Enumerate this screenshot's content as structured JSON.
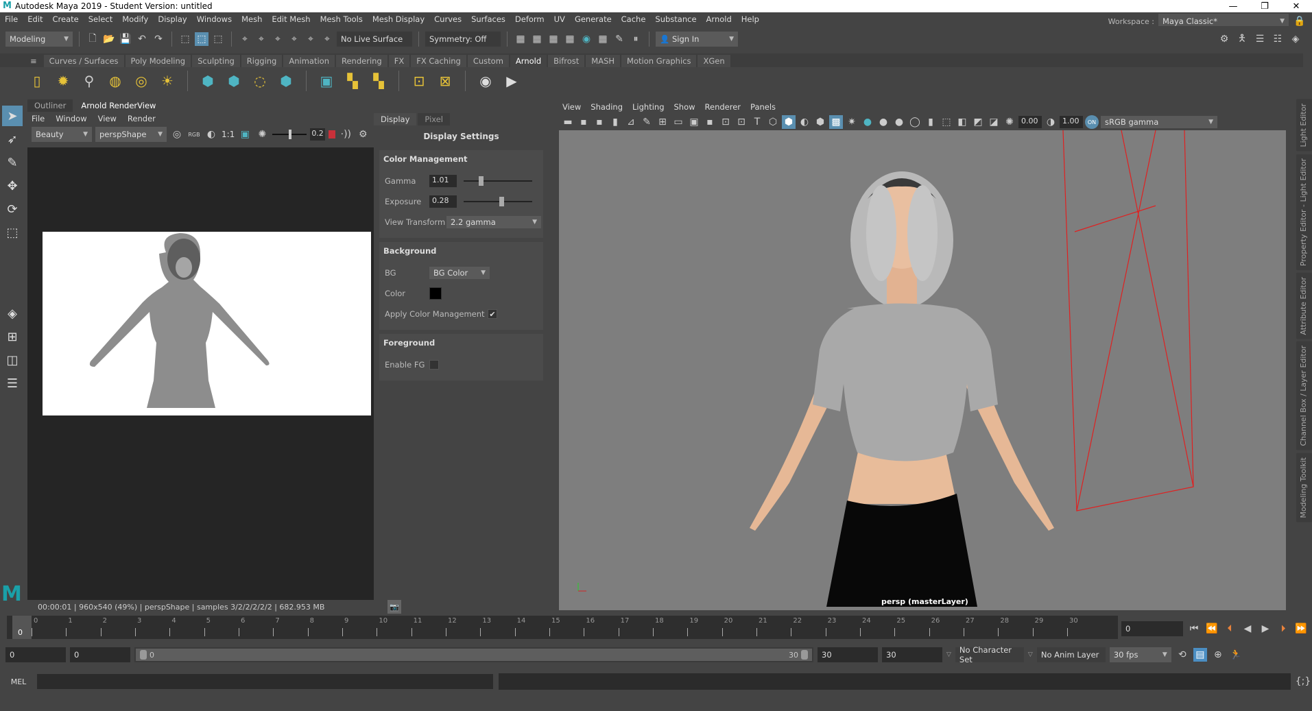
{
  "window": {
    "title": "Autodesk Maya 2019 - Student Version: untitled",
    "controls": [
      "minimize",
      "restore",
      "close"
    ]
  },
  "menubar": [
    "File",
    "Edit",
    "Create",
    "Select",
    "Modify",
    "Display",
    "Windows",
    "Mesh",
    "Edit Mesh",
    "Mesh Tools",
    "Mesh Display",
    "Curves",
    "Surfaces",
    "Deform",
    "UV",
    "Generate",
    "Cache",
    "Substance",
    "Arnold",
    "Help"
  ],
  "statusline": {
    "menuset": "Modeling",
    "live_surface": "No Live Surface",
    "symmetry": "Symmetry: Off",
    "sign_in": "Sign In",
    "workspace_label": "Workspace :",
    "workspace_value": "Maya Classic*"
  },
  "shelf": {
    "tabs": [
      "Curves / Surfaces",
      "Poly Modeling",
      "Sculpting",
      "Rigging",
      "Animation",
      "Rendering",
      "FX",
      "FX Caching",
      "Custom",
      "Arnold",
      "Bifrost",
      "MASH",
      "Motion Graphics",
      "XGen"
    ],
    "active_tab": "Arnold"
  },
  "renderview": {
    "tabs": [
      "Outliner",
      "Arnold RenderView"
    ],
    "active_tab": "Arnold RenderView",
    "menu": [
      "File",
      "Window",
      "View",
      "Render"
    ],
    "aov": "Beauty",
    "camera": "perspShape",
    "ratio_label": "1:1",
    "exposure_value": "0.2",
    "status": "00:00:01 | 960x540 (49%) | perspShape  | samples 3/2/2/2/2/2 | 682.953 MB"
  },
  "display_panel": {
    "tabs": [
      "Display",
      "Pixel"
    ],
    "active_tab": "Display",
    "title": "Display Settings",
    "color_management": {
      "heading": "Color Management",
      "gamma_label": "Gamma",
      "gamma": "1.01",
      "exposure_label": "Exposure",
      "exposure": "0.28",
      "view_transform_label": "View Transform",
      "view_transform": "2.2 gamma"
    },
    "background": {
      "heading": "Background",
      "bg_label": "BG",
      "bg_value": "BG Color",
      "color_label": "Color",
      "color": "#000000",
      "apply_cm_label": "Apply Color Management",
      "apply_cm": true
    },
    "foreground": {
      "heading": "Foreground",
      "enable_fg_label": "Enable FG",
      "enable_fg": false
    }
  },
  "viewport": {
    "menu": [
      "View",
      "Shading",
      "Lighting",
      "Show",
      "Renderer",
      "Panels"
    ],
    "exposure": "0.00",
    "gamma": "1.00",
    "color_space": "sRGB gamma",
    "camera_label": "persp (masterLayer)"
  },
  "side_tabs": [
    "Light Editor",
    "Property Editor - Light Editor",
    "Attribute Editor",
    "Channel Box / Layer Editor",
    "Modeling Toolkit"
  ],
  "timeslider": {
    "ticks": [
      0,
      1,
      2,
      3,
      4,
      5,
      6,
      7,
      8,
      9,
      10,
      11,
      12,
      13,
      14,
      15,
      16,
      17,
      18,
      19,
      20,
      21,
      22,
      23,
      24,
      25,
      26,
      27,
      28,
      29,
      30
    ],
    "current_frame": "0",
    "current_frame_field": "0"
  },
  "range": {
    "start": "0",
    "anim_start": "0",
    "slider_start": "0",
    "slider_end": "30",
    "anim_end": "30",
    "end": "30",
    "character_set": "No Character Set",
    "anim_layer": "No Anim Layer",
    "fps": "30 fps"
  },
  "commandline": {
    "mode": "MEL"
  }
}
